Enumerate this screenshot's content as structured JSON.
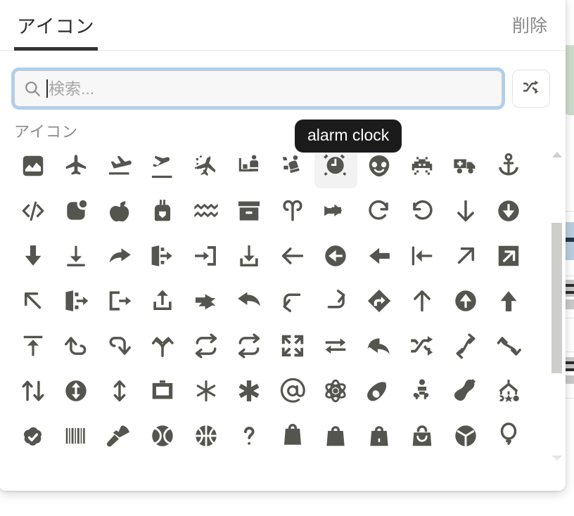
{
  "header": {
    "tabs": [
      {
        "label": "アイコン",
        "active": true
      }
    ],
    "delete_label": "削除"
  },
  "search": {
    "value": "",
    "placeholder": "検索...",
    "icon": "search-icon",
    "caret_visible": true,
    "focused": true
  },
  "shuffle": {
    "icon": "shuffle-icon",
    "label": ""
  },
  "section": {
    "label": "アイコン"
  },
  "tooltip": {
    "text": "alarm clock",
    "visible": true
  },
  "scrollbar": {
    "up_icon": "triangle-up-icon",
    "down_icon": "triangle-down-icon",
    "thumb_top_pct": 21,
    "thumb_height_pct": 52
  },
  "colors": {
    "accent": "#333333",
    "focus_ring": "#aed0f0",
    "icon": "#55554f",
    "tooltip_bg": "#1b1b1b",
    "hover_bg": "#f2f2f2",
    "muted_text": "#8a8a8a",
    "scrollbar_thumb": "#cdcdc9"
  },
  "grid": {
    "columns": 12,
    "hovered_index": 7,
    "icons": [
      "chart-area-icon",
      "plane-icon",
      "plane-arrival-icon",
      "plane-departure-icon",
      "plane-slash-icon",
      "person-seat-icon",
      "person-seat-reclined-icon",
      "alarm-clock-icon",
      "alien-icon",
      "space-invader-icon",
      "ambulance-icon",
      "anchor-icon",
      "code-icon",
      "app-icon",
      "apple-whole-icon",
      "apron-icon",
      "waves-icon",
      "archive-box-icon",
      "aries-icon",
      "arrow-progress-icon",
      "arrow-rotate-right-icon",
      "arrow-rotate-left-icon",
      "arrow-down-icon",
      "circle-arrow-down-icon",
      "arrow-down-solid-icon",
      "arrow-down-to-line-icon",
      "arrow-turn-right-icon",
      "arrow-right-to-door-icon",
      "arrow-right-to-bracket-icon",
      "arrow-down-to-bracket-icon",
      "arrow-left-icon",
      "circle-arrow-left-icon",
      "arrow-left-solid-icon",
      "arrow-left-to-line-icon",
      "arrow-up-right-icon",
      "square-arrow-up-right-icon",
      "arrow-up-left-icon",
      "arrow-right-from-door-icon",
      "arrow-right-from-bracket-icon",
      "arrow-up-from-bracket-icon",
      "arrow-turn-right-solid-icon",
      "arrow-turn-up-left-icon",
      "arrow-turn-down-left-icon",
      "arrow-turn-up-right-icon",
      "diamond-turn-right-icon",
      "arrow-up-icon",
      "circle-arrow-up-icon",
      "arrow-up-solid-icon",
      "arrow-up-to-line-icon",
      "arrow-turn-down-icon",
      "arrow-turn-up-icon",
      "arrows-split-up-and-left-icon",
      "arrows-repeat-icon",
      "arrows-repeat-1-icon",
      "arrows-maximize-icon",
      "arrows-repeat-alt-icon",
      "reply-all-icon",
      "shuffle-icon",
      "arrow-turn-curve-right-icon",
      "arrow-turn-curve-up-icon",
      "arrow-up-arrow-down-icon",
      "circle-arrows-up-down-icon",
      "arrows-up-down-icon",
      "artboard-icon",
      "asterisk-light-icon",
      "asterisk-icon",
      "at-icon",
      "atom-icon",
      "avocado-icon",
      "baby-icon",
      "bacon-icon",
      "baby-mobile-icon",
      "badge-check-icon",
      "barcode-icon",
      "badminton-icon",
      "baseball-icon",
      "basketball-icon",
      "question-icon",
      "bag-icon",
      "bag-shopping-icon",
      "bag-seedling-icon",
      "bag-handle-icon",
      "ball-icon",
      "balloon-icon"
    ]
  }
}
